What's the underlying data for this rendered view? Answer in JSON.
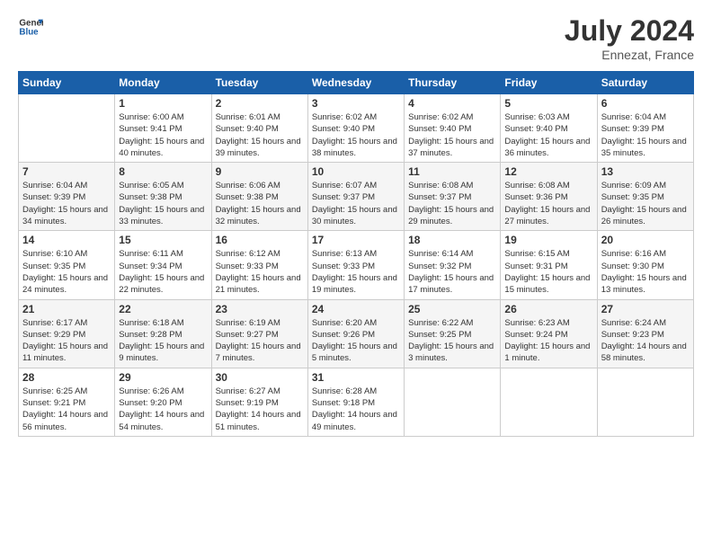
{
  "header": {
    "logo_line1": "General",
    "logo_line2": "Blue",
    "month_year": "July 2024",
    "location": "Ennezat, France"
  },
  "weekdays": [
    "Sunday",
    "Monday",
    "Tuesday",
    "Wednesday",
    "Thursday",
    "Friday",
    "Saturday"
  ],
  "weeks": [
    [
      {
        "day": "",
        "empty": true
      },
      {
        "day": "1",
        "sunrise": "Sunrise: 6:00 AM",
        "sunset": "Sunset: 9:41 PM",
        "daylight": "Daylight: 15 hours and 40 minutes."
      },
      {
        "day": "2",
        "sunrise": "Sunrise: 6:01 AM",
        "sunset": "Sunset: 9:40 PM",
        "daylight": "Daylight: 15 hours and 39 minutes."
      },
      {
        "day": "3",
        "sunrise": "Sunrise: 6:02 AM",
        "sunset": "Sunset: 9:40 PM",
        "daylight": "Daylight: 15 hours and 38 minutes."
      },
      {
        "day": "4",
        "sunrise": "Sunrise: 6:02 AM",
        "sunset": "Sunset: 9:40 PM",
        "daylight": "Daylight: 15 hours and 37 minutes."
      },
      {
        "day": "5",
        "sunrise": "Sunrise: 6:03 AM",
        "sunset": "Sunset: 9:40 PM",
        "daylight": "Daylight: 15 hours and 36 minutes."
      },
      {
        "day": "6",
        "sunrise": "Sunrise: 6:04 AM",
        "sunset": "Sunset: 9:39 PM",
        "daylight": "Daylight: 15 hours and 35 minutes."
      }
    ],
    [
      {
        "day": "7",
        "sunrise": "Sunrise: 6:04 AM",
        "sunset": "Sunset: 9:39 PM",
        "daylight": "Daylight: 15 hours and 34 minutes."
      },
      {
        "day": "8",
        "sunrise": "Sunrise: 6:05 AM",
        "sunset": "Sunset: 9:38 PM",
        "daylight": "Daylight: 15 hours and 33 minutes."
      },
      {
        "day": "9",
        "sunrise": "Sunrise: 6:06 AM",
        "sunset": "Sunset: 9:38 PM",
        "daylight": "Daylight: 15 hours and 32 minutes."
      },
      {
        "day": "10",
        "sunrise": "Sunrise: 6:07 AM",
        "sunset": "Sunset: 9:37 PM",
        "daylight": "Daylight: 15 hours and 30 minutes."
      },
      {
        "day": "11",
        "sunrise": "Sunrise: 6:08 AM",
        "sunset": "Sunset: 9:37 PM",
        "daylight": "Daylight: 15 hours and 29 minutes."
      },
      {
        "day": "12",
        "sunrise": "Sunrise: 6:08 AM",
        "sunset": "Sunset: 9:36 PM",
        "daylight": "Daylight: 15 hours and 27 minutes."
      },
      {
        "day": "13",
        "sunrise": "Sunrise: 6:09 AM",
        "sunset": "Sunset: 9:35 PM",
        "daylight": "Daylight: 15 hours and 26 minutes."
      }
    ],
    [
      {
        "day": "14",
        "sunrise": "Sunrise: 6:10 AM",
        "sunset": "Sunset: 9:35 PM",
        "daylight": "Daylight: 15 hours and 24 minutes."
      },
      {
        "day": "15",
        "sunrise": "Sunrise: 6:11 AM",
        "sunset": "Sunset: 9:34 PM",
        "daylight": "Daylight: 15 hours and 22 minutes."
      },
      {
        "day": "16",
        "sunrise": "Sunrise: 6:12 AM",
        "sunset": "Sunset: 9:33 PM",
        "daylight": "Daylight: 15 hours and 21 minutes."
      },
      {
        "day": "17",
        "sunrise": "Sunrise: 6:13 AM",
        "sunset": "Sunset: 9:33 PM",
        "daylight": "Daylight: 15 hours and 19 minutes."
      },
      {
        "day": "18",
        "sunrise": "Sunrise: 6:14 AM",
        "sunset": "Sunset: 9:32 PM",
        "daylight": "Daylight: 15 hours and 17 minutes."
      },
      {
        "day": "19",
        "sunrise": "Sunrise: 6:15 AM",
        "sunset": "Sunset: 9:31 PM",
        "daylight": "Daylight: 15 hours and 15 minutes."
      },
      {
        "day": "20",
        "sunrise": "Sunrise: 6:16 AM",
        "sunset": "Sunset: 9:30 PM",
        "daylight": "Daylight: 15 hours and 13 minutes."
      }
    ],
    [
      {
        "day": "21",
        "sunrise": "Sunrise: 6:17 AM",
        "sunset": "Sunset: 9:29 PM",
        "daylight": "Daylight: 15 hours and 11 minutes."
      },
      {
        "day": "22",
        "sunrise": "Sunrise: 6:18 AM",
        "sunset": "Sunset: 9:28 PM",
        "daylight": "Daylight: 15 hours and 9 minutes."
      },
      {
        "day": "23",
        "sunrise": "Sunrise: 6:19 AM",
        "sunset": "Sunset: 9:27 PM",
        "daylight": "Daylight: 15 hours and 7 minutes."
      },
      {
        "day": "24",
        "sunrise": "Sunrise: 6:20 AM",
        "sunset": "Sunset: 9:26 PM",
        "daylight": "Daylight: 15 hours and 5 minutes."
      },
      {
        "day": "25",
        "sunrise": "Sunrise: 6:22 AM",
        "sunset": "Sunset: 9:25 PM",
        "daylight": "Daylight: 15 hours and 3 minutes."
      },
      {
        "day": "26",
        "sunrise": "Sunrise: 6:23 AM",
        "sunset": "Sunset: 9:24 PM",
        "daylight": "Daylight: 15 hours and 1 minute."
      },
      {
        "day": "27",
        "sunrise": "Sunrise: 6:24 AM",
        "sunset": "Sunset: 9:23 PM",
        "daylight": "Daylight: 14 hours and 58 minutes."
      }
    ],
    [
      {
        "day": "28",
        "sunrise": "Sunrise: 6:25 AM",
        "sunset": "Sunset: 9:21 PM",
        "daylight": "Daylight: 14 hours and 56 minutes."
      },
      {
        "day": "29",
        "sunrise": "Sunrise: 6:26 AM",
        "sunset": "Sunset: 9:20 PM",
        "daylight": "Daylight: 14 hours and 54 minutes."
      },
      {
        "day": "30",
        "sunrise": "Sunrise: 6:27 AM",
        "sunset": "Sunset: 9:19 PM",
        "daylight": "Daylight: 14 hours and 51 minutes."
      },
      {
        "day": "31",
        "sunrise": "Sunrise: 6:28 AM",
        "sunset": "Sunset: 9:18 PM",
        "daylight": "Daylight: 14 hours and 49 minutes."
      },
      {
        "day": "",
        "empty": true
      },
      {
        "day": "",
        "empty": true
      },
      {
        "day": "",
        "empty": true
      }
    ]
  ]
}
